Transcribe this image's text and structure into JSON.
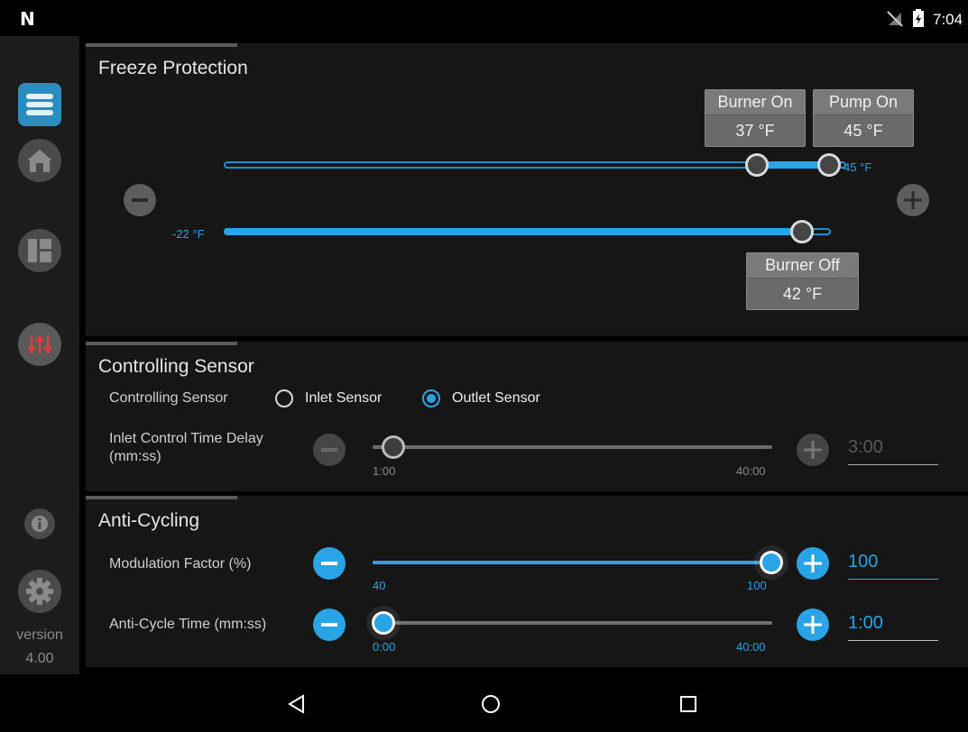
{
  "status_bar": {
    "logo": "N",
    "time": "7:04"
  },
  "sidebar": {
    "items": [
      {
        "name": "menu",
        "icon": "hamburger-icon"
      },
      {
        "name": "home",
        "icon": "home-icon"
      },
      {
        "name": "dashboard",
        "icon": "dashboard-icon"
      },
      {
        "name": "adjust",
        "icon": "sliders-icon",
        "active": true
      },
      {
        "name": "info",
        "icon": "info-icon"
      },
      {
        "name": "settings",
        "icon": "gear-icon"
      }
    ],
    "version_label": "version",
    "version_number": "4.00"
  },
  "freeze_protection": {
    "title": "Freeze Protection",
    "upper_slider": {
      "burner_on_value": 37,
      "pump_on_value": 45,
      "end_label": "45 °F"
    },
    "lower_slider": {
      "start_label": "-22 °F",
      "burner_off_value": 42
    },
    "tooltips": {
      "burner_on": {
        "label": "Burner On",
        "value": "37 °F"
      },
      "pump_on": {
        "label": "Pump On",
        "value": "45 °F"
      },
      "burner_off": {
        "label": "Burner Off",
        "value": "42 °F"
      }
    }
  },
  "controlling_sensor": {
    "title": "Controlling Sensor",
    "sensor_label": "Controlling Sensor",
    "options": [
      {
        "label": "Inlet Sensor",
        "selected": false
      },
      {
        "label": "Outlet Sensor",
        "selected": true
      }
    ],
    "delay": {
      "label_line1": "Inlet Control Time Delay",
      "label_line2": "(mm:ss)",
      "min": "1:00",
      "max": "40:00",
      "value": "3:00",
      "enabled": false
    }
  },
  "anti_cycling": {
    "title": "Anti-Cycling",
    "modulation": {
      "label": "Modulation Factor (%)",
      "min": "40",
      "max": "100",
      "value": "100"
    },
    "cycle_time": {
      "label": "Anti-Cycle Time (mm:ss)",
      "min": "0:00",
      "max": "40:00",
      "value": "1:00"
    }
  },
  "colors": {
    "accent": "#29a4e6",
    "panel": "#161616",
    "sidebar": "#1c1c1c"
  }
}
